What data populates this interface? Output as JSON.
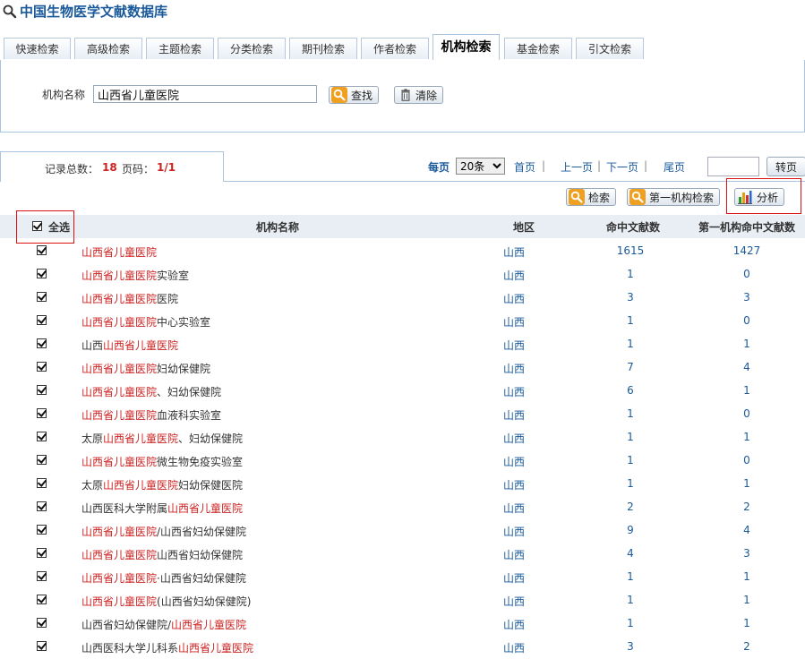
{
  "app": {
    "title": "中国生物医学文献数据库"
  },
  "tabs": [
    {
      "label": "快速检索",
      "active": false
    },
    {
      "label": "高级检索",
      "active": false
    },
    {
      "label": "主题检索",
      "active": false
    },
    {
      "label": "分类检索",
      "active": false
    },
    {
      "label": "期刊检索",
      "active": false
    },
    {
      "label": "作者检索",
      "active": false
    },
    {
      "label": "机构检索",
      "active": true
    },
    {
      "label": "基金检索",
      "active": false
    },
    {
      "label": "引文检索",
      "active": false
    }
  ],
  "search": {
    "org_label": "机构名称",
    "org_value": "山西省儿童医院",
    "find_label": "查找",
    "clear_label": "清除"
  },
  "results": {
    "total_label": "记录总数：",
    "total": "18",
    "page_label": "页码：",
    "page": "1/1"
  },
  "pager": {
    "per_page_label": "每页",
    "per_page_value": "20条",
    "per_page_options": [
      "20条"
    ],
    "first": "首页",
    "prev": "上一页",
    "next": "下一页",
    "last": "尾页",
    "sep": "|",
    "jump_label": "转页"
  },
  "actions": {
    "search_label": "检索",
    "first_org_search_label": "第一机构检索",
    "analyze_label": "分析"
  },
  "table": {
    "select_all": "全选",
    "headers": {
      "name": "机构名称",
      "region": "地区",
      "hits": "命中文献数",
      "first_hits": "第一机构命中文献数"
    },
    "rows": [
      {
        "pre": "",
        "hl": "山西省儿童医院",
        "post": "",
        "region": "山西",
        "hits": "1615",
        "first": "1427"
      },
      {
        "pre": "",
        "hl": "山西省儿童医院",
        "post": "实验室",
        "region": "山西",
        "hits": "1",
        "first": "0"
      },
      {
        "pre": "",
        "hl": "山西省儿童医院",
        "post": "医院",
        "region": "山西",
        "hits": "3",
        "first": "3"
      },
      {
        "pre": "",
        "hl": "山西省儿童医院",
        "post": "中心实验室",
        "region": "山西",
        "hits": "1",
        "first": "0"
      },
      {
        "pre": "山西",
        "hl": "山西省儿童医院",
        "post": "",
        "region": "山西",
        "hits": "1",
        "first": "1"
      },
      {
        "pre": "",
        "hl": "山西省儿童医院",
        "post": "妇幼保健院",
        "region": "山西",
        "hits": "7",
        "first": "4"
      },
      {
        "pre": "",
        "hl": "山西省儿童医院",
        "post": "、妇幼保健院",
        "region": "山西",
        "hits": "6",
        "first": "1"
      },
      {
        "pre": "",
        "hl": "山西省儿童医院",
        "post": "血液科实验室",
        "region": "山西",
        "hits": "1",
        "first": "0"
      },
      {
        "pre": "太原",
        "hl": "山西省儿童医院",
        "post": "、妇幼保健院",
        "region": "山西",
        "hits": "1",
        "first": "1"
      },
      {
        "pre": "",
        "hl": "山西省儿童医院",
        "post": "微生物免疫实验室",
        "region": "山西",
        "hits": "1",
        "first": "0"
      },
      {
        "pre": "太原",
        "hl": "山西省儿童医院",
        "post": "妇幼保健医院",
        "region": "山西",
        "hits": "1",
        "first": "1"
      },
      {
        "pre": "山西医科大学附属",
        "hl": "山西省儿童医院",
        "post": "",
        "region": "山西",
        "hits": "2",
        "first": "2"
      },
      {
        "pre": "",
        "hl": "山西省儿童医院",
        "post": "/山西省妇幼保健院",
        "region": "山西",
        "hits": "9",
        "first": "4"
      },
      {
        "pre": "",
        "hl": "山西省儿童医院",
        "post": "山西省妇幼保健院",
        "region": "山西",
        "hits": "4",
        "first": "3"
      },
      {
        "pre": "",
        "hl": "山西省儿童医院",
        "post": "·山西省妇幼保健院",
        "region": "山西",
        "hits": "1",
        "first": "1"
      },
      {
        "pre": "",
        "hl": "山西省儿童医院",
        "post": "(山西省妇幼保健院)",
        "region": "山西",
        "hits": "1",
        "first": "1"
      },
      {
        "pre": "山西省妇幼保健院/",
        "hl": "山西省儿童医院",
        "post": "",
        "region": "山西",
        "hits": "1",
        "first": "1"
      },
      {
        "pre": "山西医科大学儿科系",
        "hl": "山西省儿童医院",
        "post": "",
        "region": "山西",
        "hits": "3",
        "first": "2"
      }
    ]
  },
  "colors": {
    "accent": "#1a5a9a",
    "highlight": "#cc2222",
    "border": "#a9c4de",
    "header_bg": "#e8eef4"
  },
  "icons": {
    "title": "magnifier-icon",
    "find": "magnifier-icon",
    "clear": "trash-icon",
    "analyze": "bar-chart-icon"
  }
}
